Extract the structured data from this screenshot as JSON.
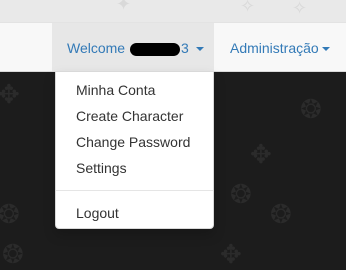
{
  "navbar": {
    "welcome": {
      "prefix": "Welcome",
      "suffix": "3",
      "active": true
    },
    "admin": {
      "label": "Administração"
    }
  },
  "dropdown": {
    "items": [
      {
        "label": "Minha Conta"
      },
      {
        "label": "Create Character"
      },
      {
        "label": "Change Password"
      },
      {
        "label": "Settings"
      }
    ],
    "footer_item": {
      "label": "Logout"
    }
  },
  "colors": {
    "link": "#337ab7",
    "menu_text": "#333333",
    "navbar_bg": "#f8f8f8",
    "active_bg": "#e7e7e7",
    "page_bg": "#1c1c1c"
  },
  "icons": {
    "caret": "caret-down-icon",
    "redaction": "redaction-mark"
  }
}
